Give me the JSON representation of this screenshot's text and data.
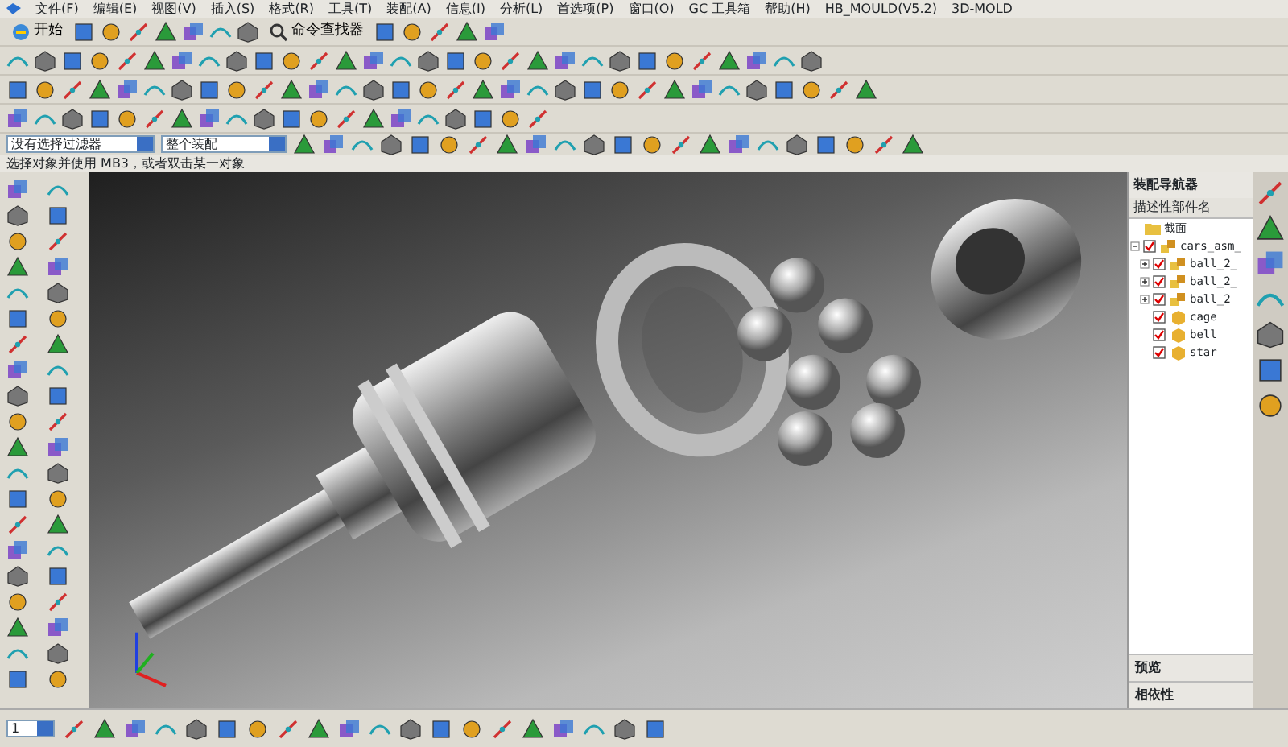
{
  "menu": [
    "文件(F)",
    "编辑(E)",
    "视图(V)",
    "插入(S)",
    "格式(R)",
    "工具(T)",
    "装配(A)",
    "信息(I)",
    "分析(L)",
    "首选项(P)",
    "窗口(O)",
    "GC 工具箱",
    "帮助(H)",
    "HB_MOULD(V5.2)",
    "3D-MOLD"
  ],
  "toolbar": {
    "start": "开始",
    "command_finder": "命令查找器"
  },
  "selection_bar": {
    "filter": "没有选择过滤器",
    "scope": "整个装配"
  },
  "status": "选择对象并使用 MB3，或者双击某一对象",
  "navigator": {
    "title": "装配导航器",
    "column": "描述性部件名",
    "tree": [
      {
        "label": "截面",
        "kind": "folder"
      },
      {
        "label": "cars_asm_",
        "kind": "assembly",
        "checked": true,
        "expanded": true,
        "children": [
          {
            "label": "ball_2_",
            "kind": "assembly",
            "checked": true,
            "expanded": false
          },
          {
            "label": "ball_2_",
            "kind": "assembly",
            "checked": true,
            "expanded": false
          },
          {
            "label": "ball_2",
            "kind": "assembly",
            "checked": true,
            "expanded": false
          },
          {
            "label": "cage",
            "kind": "part",
            "checked": true
          },
          {
            "label": "bell",
            "kind": "part",
            "checked": true
          },
          {
            "label": "star",
            "kind": "part",
            "checked": true
          }
        ]
      }
    ],
    "sections": [
      "预览",
      "相依性"
    ]
  },
  "layer": "1"
}
